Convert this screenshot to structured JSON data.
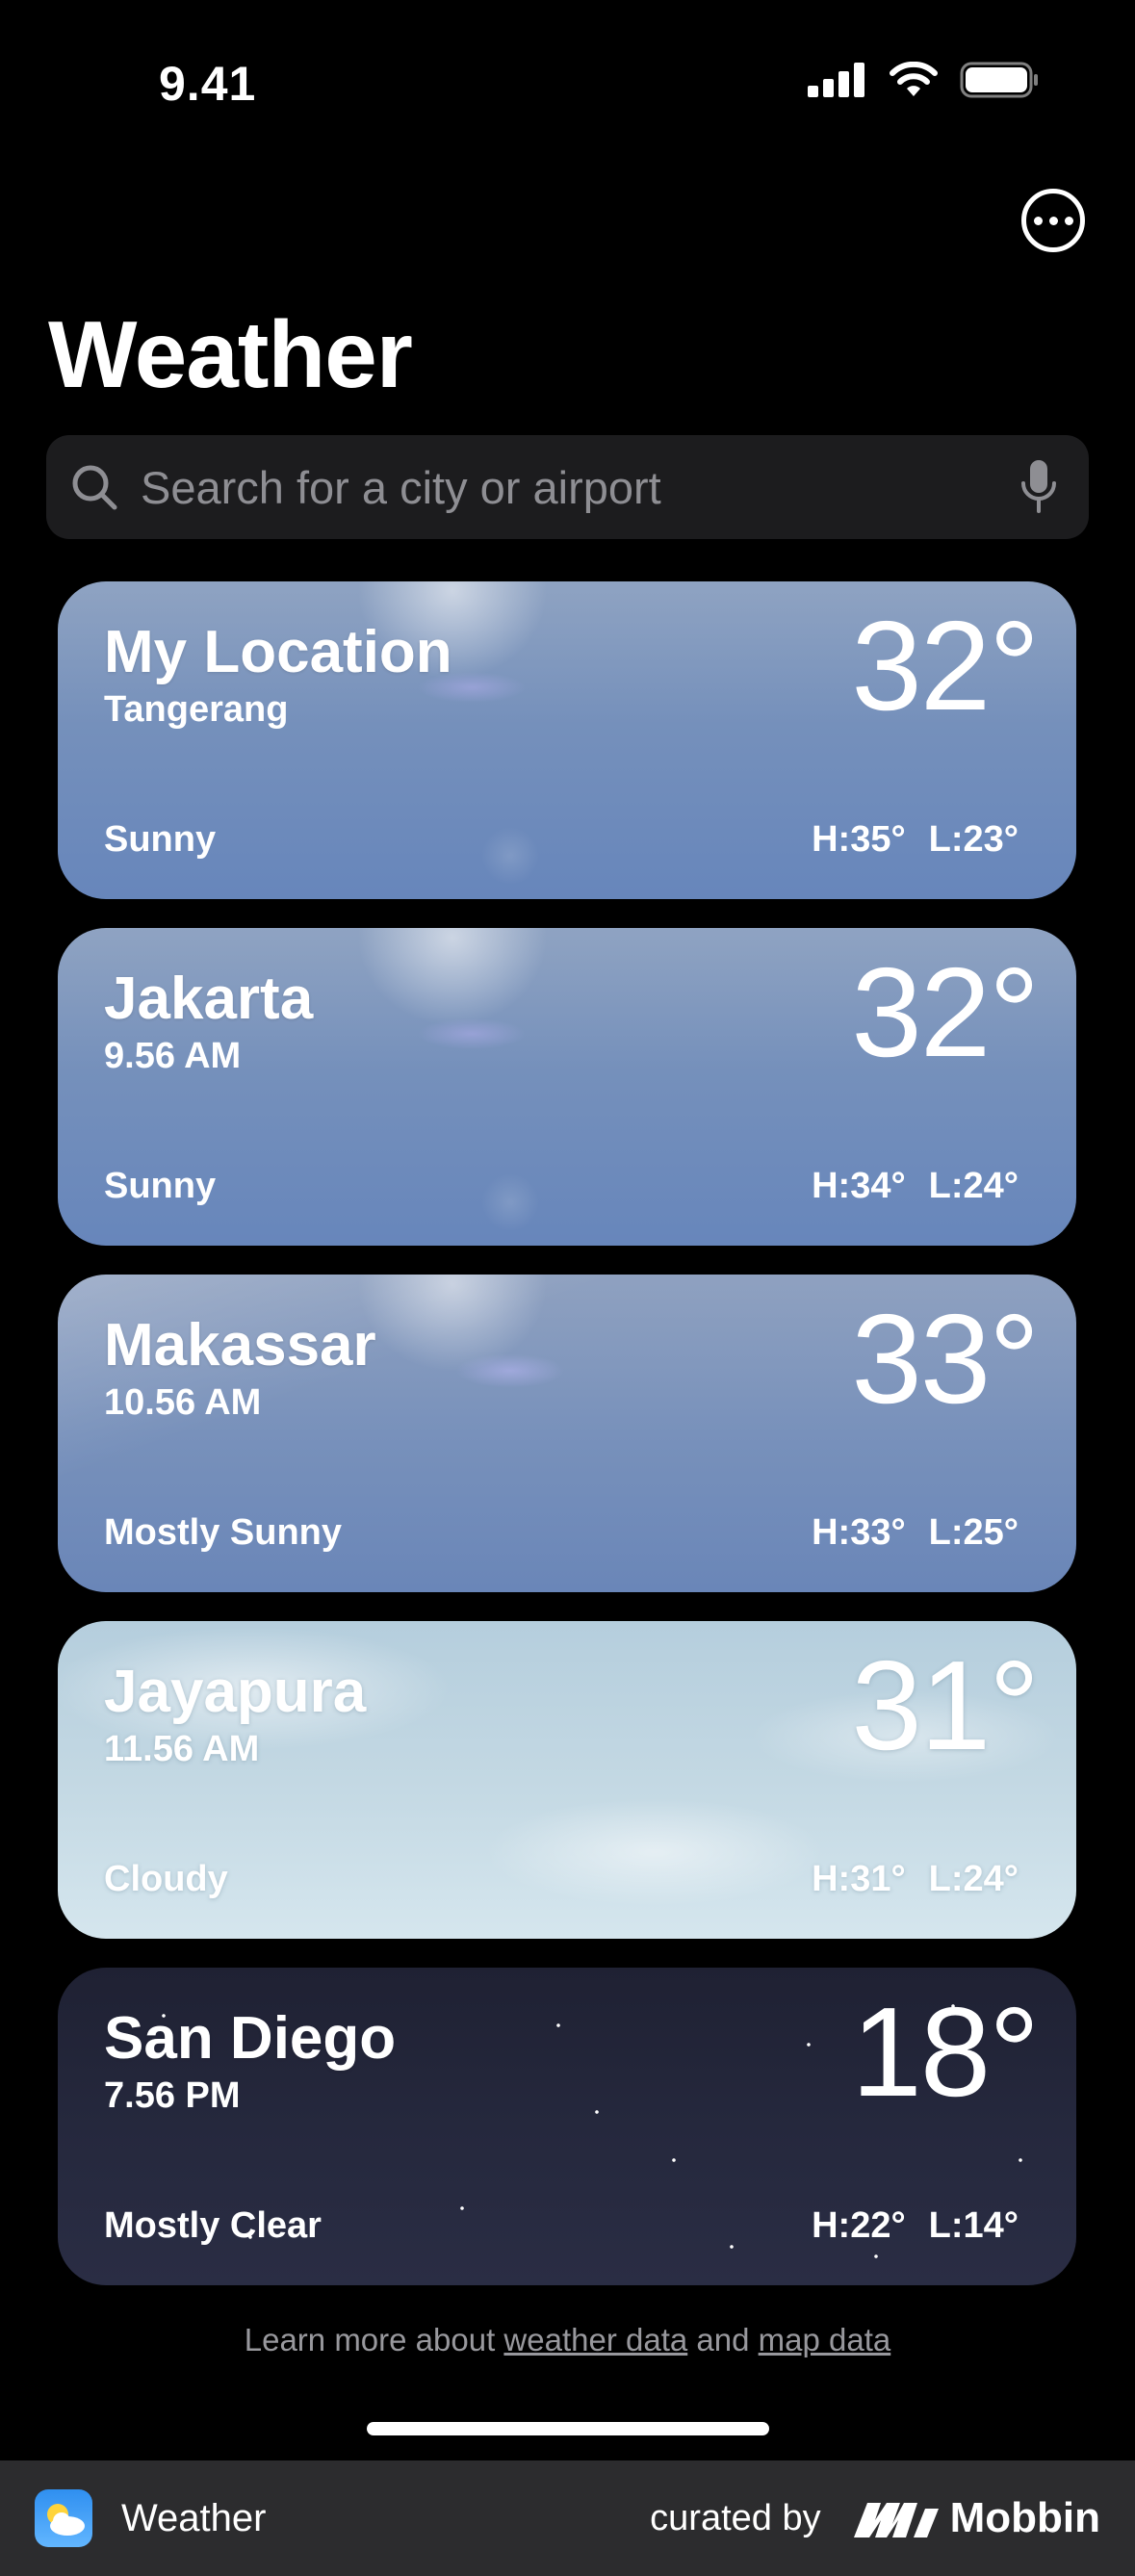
{
  "status_bar": {
    "time": "9.41"
  },
  "header": {
    "title": "Weather"
  },
  "search": {
    "placeholder": "Search for a city or airport"
  },
  "locations": [
    {
      "name": "My Location",
      "subtitle": "Tangerang",
      "temp": "32°",
      "condition": "Sunny",
      "high": "H:35°",
      "low": "L:23°"
    },
    {
      "name": "Jakarta",
      "subtitle": "9.56 AM",
      "temp": "32°",
      "condition": "Sunny",
      "high": "H:34°",
      "low": "L:24°"
    },
    {
      "name": "Makassar",
      "subtitle": "10.56 AM",
      "temp": "33°",
      "condition": "Mostly Sunny",
      "high": "H:33°",
      "low": "L:25°"
    },
    {
      "name": "Jayapura",
      "subtitle": "11.56 AM",
      "temp": "31°",
      "condition": "Cloudy",
      "high": "H:31°",
      "low": "L:24°"
    },
    {
      "name": "San Diego",
      "subtitle": "7.56 PM",
      "temp": "18°",
      "condition": "Mostly Clear",
      "high": "H:22°",
      "low": "L:14°"
    }
  ],
  "footer": {
    "prefix": "Learn more about ",
    "weather_link": "weather data",
    "middle": " and ",
    "map_link": "map data"
  },
  "bottom_bar": {
    "app_name": "Weather",
    "curated_by": "curated by",
    "brand": "Mobbin"
  }
}
